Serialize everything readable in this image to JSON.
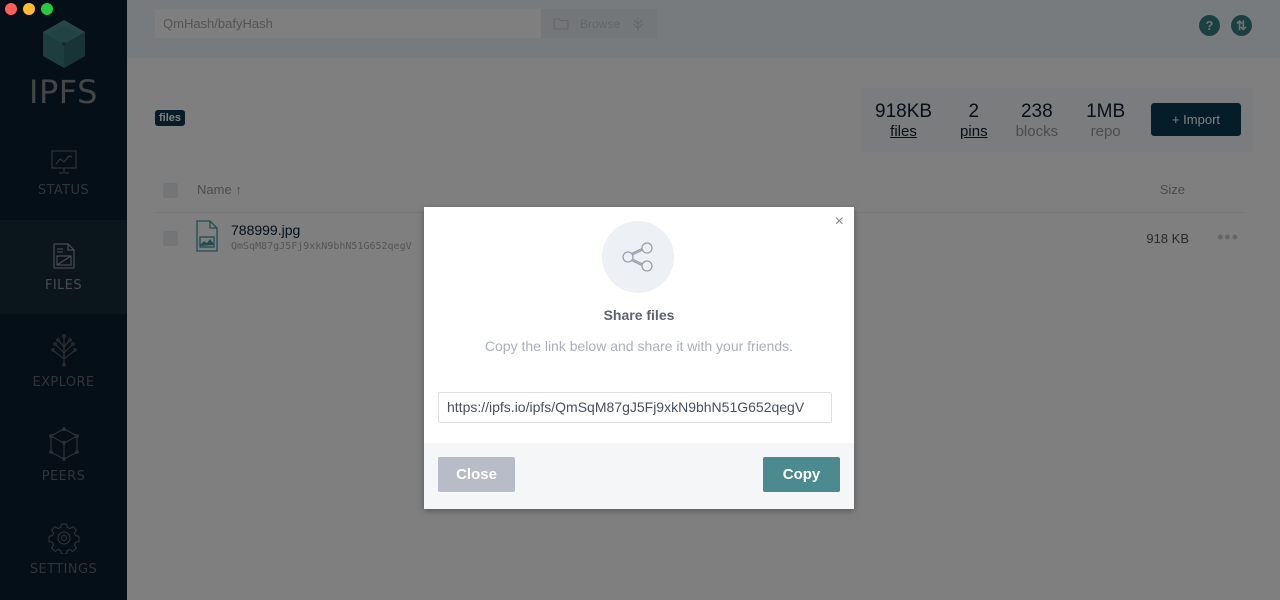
{
  "window": {
    "controls": [
      "close",
      "minimize",
      "maximize"
    ]
  },
  "sidebar": {
    "logo_text": "IPFS",
    "items": [
      {
        "label": "STATUS",
        "icon": "status-monitor-icon",
        "active": false
      },
      {
        "label": "FILES",
        "icon": "files-document-icon",
        "active": true
      },
      {
        "label": "EXPLORE",
        "icon": "explore-tree-icon",
        "active": false
      },
      {
        "label": "PEERS",
        "icon": "peers-cube-icon",
        "active": false
      },
      {
        "label": "SETTINGS",
        "icon": "settings-gear-icon",
        "active": false
      }
    ]
  },
  "topbar": {
    "search_placeholder": "QmHash/bafyHash",
    "browse_label": "Browse",
    "help_icon": "?",
    "connection_icon": "⇅"
  },
  "files": {
    "breadcrumb": "files",
    "stats": [
      {
        "value": "918KB",
        "label": "files",
        "link": true
      },
      {
        "value": "2",
        "label": "pins",
        "link": true
      },
      {
        "value": "238",
        "label": "blocks",
        "link": false
      },
      {
        "value": "1MB",
        "label": "repo",
        "link": false
      }
    ],
    "import_label": "+ Import",
    "columns": {
      "name": "Name ↑",
      "size": "Size"
    },
    "rows": [
      {
        "name": "788999.jpg",
        "hash": "QmSqM87gJ5Fj9xkN9bhN51G652qegV",
        "size": "918 KB",
        "more": "•••"
      }
    ]
  },
  "modal": {
    "close_symbol": "×",
    "title": "Share files",
    "description": "Copy the link below and share it with your friends.",
    "link_value": "https://ipfs.io/ipfs/QmSqM87gJ5Fj9xkN9bhN51G652qegV",
    "close_label": "Close",
    "copy_label": "Copy",
    "accent_color": "#4b8a8f"
  }
}
